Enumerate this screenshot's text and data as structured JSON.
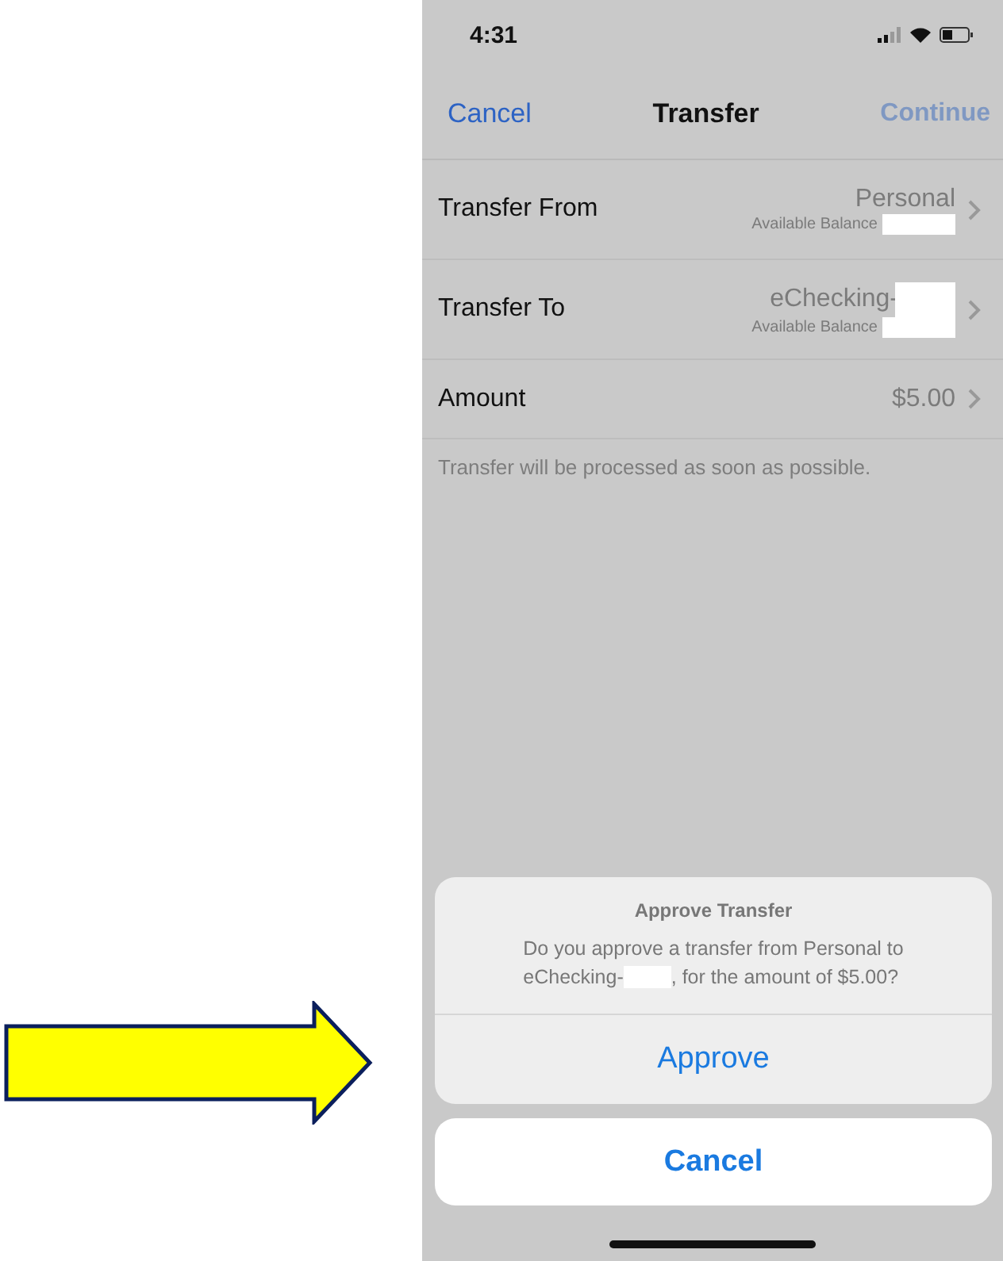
{
  "status_bar": {
    "time": "4:31"
  },
  "nav_bar": {
    "cancel": "Cancel",
    "title": "Transfer",
    "continue": {
      "label": "Continue",
      "disabled": true
    }
  },
  "rows": [
    {
      "kind": "account",
      "label": "Transfer From",
      "value": "Personal",
      "value_redacted": false,
      "balance_label": "Available Balance"
    },
    {
      "kind": "account",
      "label": "Transfer To",
      "value": "eChecking-",
      "value_redacted": true,
      "balance_label": "Available Balance"
    },
    {
      "kind": "amount",
      "label": "Amount",
      "value": "$5.00"
    }
  ],
  "footer_note": "Transfer will be processed as soon as possible.",
  "action_sheet": {
    "title": "Approve Transfer",
    "message_line_1": "Do you approve a transfer from Personal to",
    "message_line_2_start": "eChecking-",
    "message_line_2_end": ", for the amount of $5.00?",
    "approve": "Approve",
    "cancel": "Cancel"
  }
}
